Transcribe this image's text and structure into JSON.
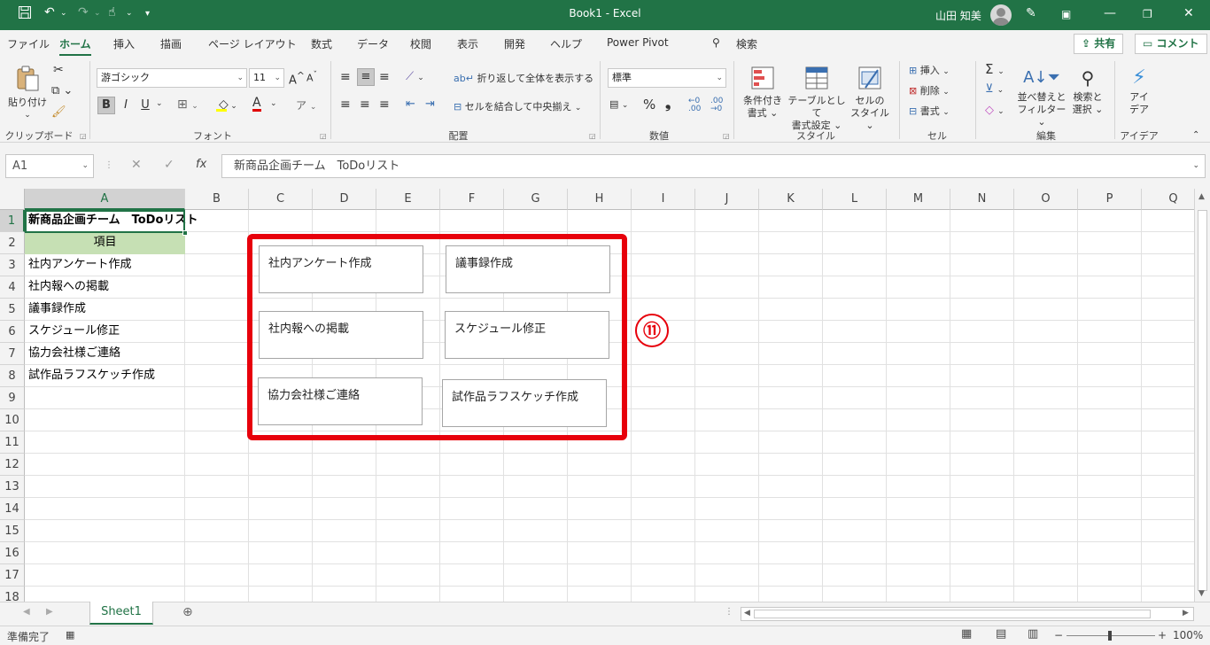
{
  "title_bar": {
    "title": "Book1  -  Excel",
    "user": "山田 知美",
    "qa_icons": [
      "save-icon",
      "undo-icon",
      "redo-icon",
      "touch-mode-icon",
      "customize-qat-icon"
    ],
    "window_controls": [
      "ribbon-display-icon",
      "minimize-icon",
      "restore-icon",
      "close-icon"
    ]
  },
  "tabs": [
    "ファイル",
    "ホーム",
    "挿入",
    "描画",
    "ページ レイアウト",
    "数式",
    "データ",
    "校閲",
    "表示",
    "開発",
    "ヘルプ",
    "Power Pivot"
  ],
  "active_tab": "ホーム",
  "search_label": "検索",
  "share_label": "共有",
  "comment_label": "コメント",
  "ribbon": {
    "clipboard": {
      "label": "クリップボード",
      "paste": "貼り付け"
    },
    "font": {
      "label": "フォント",
      "name": "游ゴシック",
      "size": "11",
      "bold": "B",
      "italic": "I",
      "underline": "U"
    },
    "alignment": {
      "label": "配置",
      "wrap_text": "折り返して全体を表示する",
      "merge_center": "セルを結合して中央揃え"
    },
    "number": {
      "label": "数値",
      "format": "標準"
    },
    "styles": {
      "label": "スタイル",
      "cond_format": [
        "条件付き",
        "書式"
      ],
      "table_format": [
        "テーブルとして",
        "書式設定"
      ],
      "cell_styles": [
        "セルの",
        "スタイル"
      ]
    },
    "cells": {
      "label": "セル",
      "insert": "挿入",
      "delete": "削除",
      "format": "書式"
    },
    "editing": {
      "label": "編集",
      "sort_filter": [
        "並べ替えと",
        "フィルター"
      ],
      "find_select": [
        "検索と",
        "選択"
      ]
    },
    "ideas": {
      "label": "アイデア",
      "button": [
        "アイ",
        "デア"
      ]
    }
  },
  "formula_bar": {
    "name_box": "A1",
    "fx": "fx",
    "content": "新商品企画チーム　ToDoリスト"
  },
  "grid": {
    "columns": [
      "A",
      "B",
      "C",
      "D",
      "E",
      "F",
      "G",
      "H",
      "I",
      "J",
      "K",
      "L",
      "M",
      "N",
      "O",
      "P",
      "Q"
    ],
    "rows": [
      "1",
      "2",
      "3",
      "4",
      "5",
      "6",
      "7",
      "8",
      "9",
      "10",
      "11",
      "12",
      "13",
      "14",
      "15",
      "16",
      "17",
      "18"
    ],
    "selected_cell": "A1",
    "cells": {
      "a1": "新商品企画チーム　ToDoリスト",
      "a2": "項目",
      "a3": "社内アンケート作成",
      "a4": "社内報への掲載",
      "a5": "議事録作成",
      "a6": "スケジュール修正",
      "a7": "協力会社様ご連絡",
      "a8": "試作品ラフスケッチ作成"
    },
    "header_fill_color": "#c6e0b4"
  },
  "notes": [
    "社内アンケート作成",
    "議事録作成",
    "社内報への掲載",
    "スケジュール修正",
    "協力会社様ご連絡",
    "試作品ラフスケッチ作成"
  ],
  "callout": "⑪",
  "highlight_color": "#e7000b",
  "sheet_tabs": [
    "Sheet1"
  ],
  "status": {
    "ready": "準備完了",
    "zoom": "100%"
  },
  "accent_color": "#217346"
}
